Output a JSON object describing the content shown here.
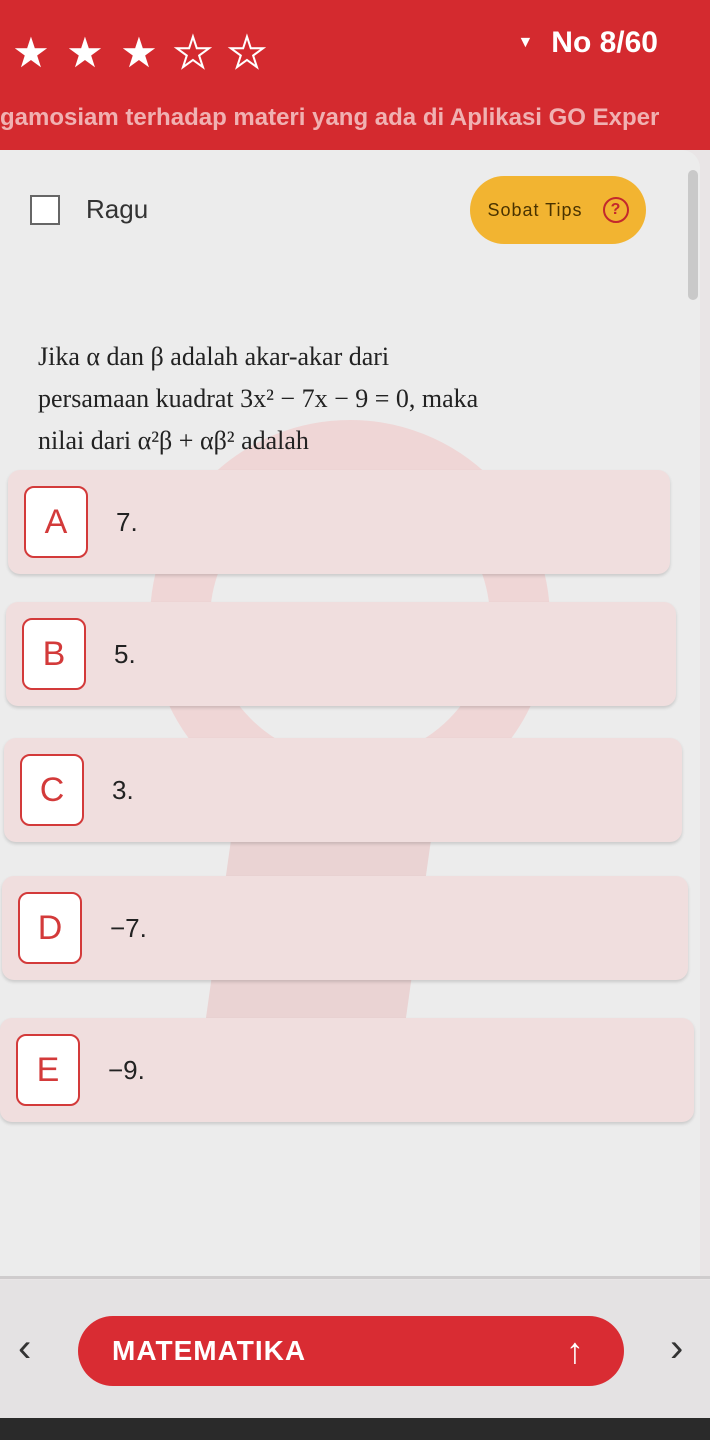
{
  "header": {
    "rating": {
      "filled": 3,
      "total": 5
    },
    "question_number": "No 8/60",
    "marquee": "gamosiam terhadap materi yang ada di Aplikasi GO Exper"
  },
  "ragu": {
    "label": "Ragu",
    "checked": false
  },
  "tips": {
    "label": "Sobat Tips",
    "icon": "question-circle-icon"
  },
  "question": {
    "line1": "Jika  α  dan  β  adalah  akar-akar  dari",
    "line2": "persamaan kuadrat 3x² − 7x − 9 = 0, maka",
    "line3": "nilai dari α²β + αβ² adalah"
  },
  "options": [
    {
      "letter": "A",
      "text": "7."
    },
    {
      "letter": "B",
      "text": "5."
    },
    {
      "letter": "C",
      "text": "3."
    },
    {
      "letter": "D",
      "text": "−7."
    },
    {
      "letter": "E",
      "text": "−9."
    }
  ],
  "footer": {
    "subject": "MATEMATIKA",
    "prev": "‹",
    "next": "›",
    "up": "↑"
  },
  "colors": {
    "brand_red": "#d42a2f",
    "tips_yellow": "#f2b431",
    "option_bg": "#f0dede"
  }
}
